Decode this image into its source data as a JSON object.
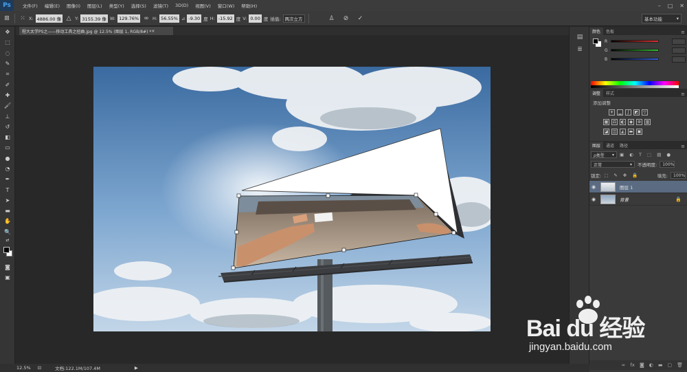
{
  "app": {
    "logo": "Ps"
  },
  "menu": [
    "文件(F)",
    "编辑(E)",
    "图像(I)",
    "图层(L)",
    "类型(Y)",
    "选择(S)",
    "滤镜(T)",
    "3D(D)",
    "视图(V)",
    "窗口(W)",
    "帮助(H)"
  ],
  "window_controls": {
    "minimize": "–",
    "maximize": "□",
    "close": "✕"
  },
  "options": {
    "x_label": "X:",
    "x_value": "4886.00 像",
    "y_label": "Y:",
    "y_value": "3155.39 像",
    "w_label": "W:",
    "w_value": "129.76%",
    "h_label": "H:",
    "h_value": "56.55%",
    "angle_label": "⊿",
    "angle_value": "-9.30",
    "angle_unit": "度",
    "hskew_label": "H:",
    "hskew_value": "-15.92",
    "hskew_unit": "度",
    "vskew_label": "V:",
    "vskew_value": "0.00",
    "vskew_unit": "度",
    "interp_label": "插值:",
    "interp_value": "两次立方",
    "workspace": "基本功能"
  },
  "document": {
    "tab_title": "程大太学PS之——移动工具之扭曲.jpg @ 12.5% (图层 1, RGB/8#) * ",
    "tab_close": "×"
  },
  "status": {
    "zoom": "12.5%",
    "doc_info": "文档:122.1M/107.4M"
  },
  "panels": {
    "color_tabs": [
      "颜色",
      "色板"
    ],
    "rgb_letters": [
      "R",
      "G",
      "B"
    ],
    "slider_colors": [
      "#e23030",
      "#30c030",
      "#3060e0"
    ],
    "adjust_tabs": [
      "调整",
      "样式"
    ],
    "adjust_title": "添加调整",
    "layers_tabs": [
      "图层",
      "通道",
      "路径"
    ],
    "kind_filter": "ρ类型",
    "blend_mode": "正常",
    "opacity_label": "不透明度:",
    "opacity_value": "100%",
    "lock_label": "锁定:",
    "fill_label": "填充:",
    "fill_value": "100%",
    "layers": [
      {
        "name": "图层 1",
        "selected": true
      },
      {
        "name": "背景",
        "selected": false
      }
    ]
  },
  "watermark": {
    "brand": "Bai du 经验",
    "url": "jingyan.baidu.com"
  }
}
